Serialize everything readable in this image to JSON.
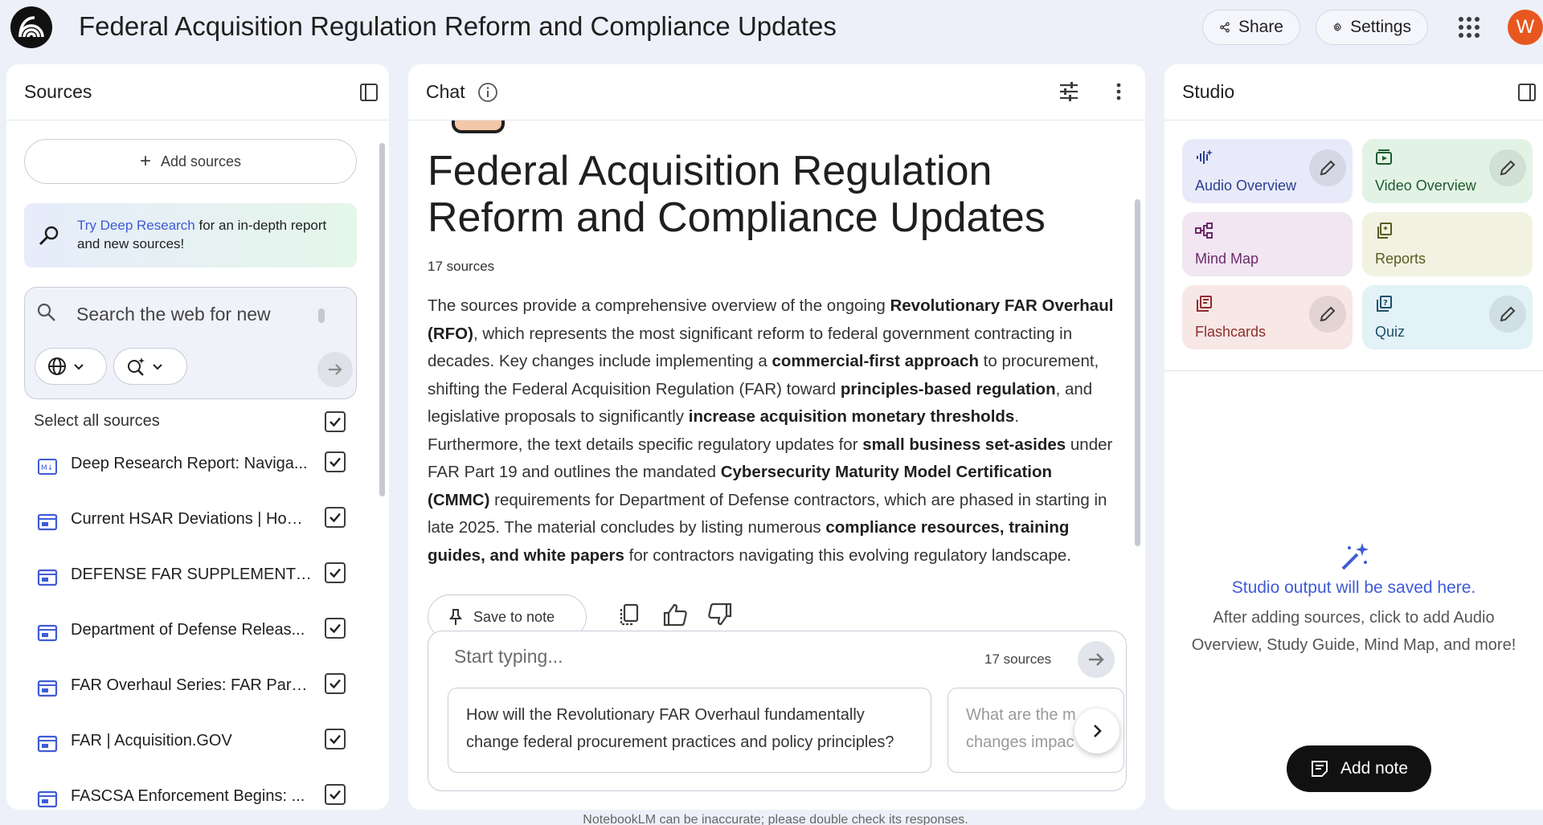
{
  "header": {
    "title": "Federal Acquisition Regulation Reform and Compliance Updates",
    "share_label": "Share",
    "settings_label": "Settings",
    "avatar_initial": "W",
    "avatar_color": "#e8571f"
  },
  "sources_panel": {
    "title": "Sources",
    "add_sources_label": "Add sources",
    "deep_research": {
      "link_text": "Try Deep Research",
      "rest_text": " for an in-depth report and new sources!"
    },
    "search": {
      "placeholder": "Search the web for new"
    },
    "select_all_label": "Select all sources",
    "items": [
      {
        "label": "Deep Research Report: Naviga...",
        "icon": "markdown-doc-icon",
        "checked": true
      },
      {
        "label": "Current HSAR Deviations | Hom...",
        "icon": "web-page-icon",
        "checked": true
      },
      {
        "label": "DEFENSE FAR SUPPLEMENT (D...",
        "icon": "web-page-icon",
        "checked": true
      },
      {
        "label": "Department of Defense Releas...",
        "icon": "web-page-icon",
        "checked": true
      },
      {
        "label": "FAR Overhaul Series: FAR Part ...",
        "icon": "web-page-icon",
        "checked": true
      },
      {
        "label": "FAR | Acquisition.GOV",
        "icon": "web-page-icon",
        "checked": true
      },
      {
        "label": "FASCSA Enforcement Begins: ...",
        "icon": "web-page-icon",
        "checked": true
      }
    ]
  },
  "chat_panel": {
    "title": "Chat",
    "notebook_title": "Federal Acquisition Regulation Reform and Compliance Updates",
    "source_count": "17 sources",
    "summary_parts": [
      {
        "t": "The sources provide a comprehensive overview of the ongoing ",
        "b": false
      },
      {
        "t": "Revolutionary FAR Overhaul (RFO)",
        "b": true
      },
      {
        "t": ", which represents the most significant reform to federal government contracting in decades. Key changes include implementing a ",
        "b": false
      },
      {
        "t": "commercial-first approach",
        "b": true
      },
      {
        "t": " to procurement, shifting the Federal Acquisition Regulation (FAR) toward ",
        "b": false
      },
      {
        "t": "principles-based regulation",
        "b": true
      },
      {
        "t": ", and legislative proposals to significantly ",
        "b": false
      },
      {
        "t": "increase acquisition monetary thresholds",
        "b": true
      },
      {
        "t": ". Furthermore, the text details specific regulatory updates for ",
        "b": false
      },
      {
        "t": "small business set-asides",
        "b": true
      },
      {
        "t": " under FAR Part 19 and outlines the mandated ",
        "b": false
      },
      {
        "t": "Cybersecurity Maturity Model Certification (CMMC)",
        "b": true
      },
      {
        "t": " requirements for Department of Defense contractors, which are phased in starting in late 2025. The material concludes by listing numerous ",
        "b": false
      },
      {
        "t": "compliance resources, training guides, and white papers",
        "b": true
      },
      {
        "t": " for contractors navigating this evolving regulatory landscape.",
        "b": false
      }
    ],
    "save_note_label": "Save to note",
    "composer": {
      "placeholder": "Start typing...",
      "source_count": "17 sources"
    },
    "suggestions": [
      "How will the Revolutionary FAR Overhaul fundamentally change federal procurement practices and policy principles?",
      "What are the m changes impac"
    ]
  },
  "studio_panel": {
    "title": "Studio",
    "tiles": [
      {
        "label": "Audio Overview",
        "icon": "audio-waveform-icon",
        "bg": "#e8eaf9",
        "fg": "#2d3f8f",
        "editable": true
      },
      {
        "label": "Video Overview",
        "icon": "video-play-icon",
        "bg": "#e2f3e6",
        "fg": "#1f5a2e",
        "editable": true
      },
      {
        "label": "Mind Map",
        "icon": "mind-map-icon",
        "bg": "#f1e6f1",
        "fg": "#6b2a6b",
        "editable": false
      },
      {
        "label": "Reports",
        "icon": "reports-icon",
        "bg": "#f2f2e3",
        "fg": "#5a5a1f",
        "editable": false
      },
      {
        "label": "Flashcards",
        "icon": "flashcards-icon",
        "bg": "#f7e7e5",
        "fg": "#8f2d2d",
        "editable": true
      },
      {
        "label": "Quiz",
        "icon": "quiz-icon",
        "bg": "#e2f2f7",
        "fg": "#1f4f6b",
        "editable": true
      }
    ],
    "empty_title": "Studio output will be saved here.",
    "empty_desc": "After adding sources, click to add Audio Overview, Study Guide, Mind Map, and more!",
    "add_note_label": "Add note"
  },
  "footer": {
    "disclaimer": "NotebookLM can be inaccurate; please double check its responses."
  }
}
